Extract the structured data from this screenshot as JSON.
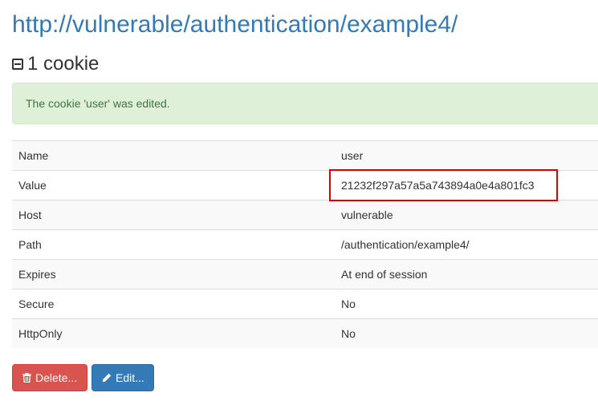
{
  "page": {
    "url_title": "http://vulnerable/authentication/example4/",
    "cookie_count_heading": "1 cookie"
  },
  "alert": {
    "message": "The cookie 'user' was edited."
  },
  "cookie": {
    "rows": [
      {
        "key": "Name",
        "value": "user"
      },
      {
        "key": "Value",
        "value": "21232f297a57a5a743894a0e4a801fc3"
      },
      {
        "key": "Host",
        "value": "vulnerable"
      },
      {
        "key": "Path",
        "value": "/authentication/example4/"
      },
      {
        "key": "Expires",
        "value": "At end of session"
      },
      {
        "key": "Secure",
        "value": "No"
      },
      {
        "key": "HttpOnly",
        "value": "No"
      }
    ]
  },
  "actions": {
    "delete_label": "Delete...",
    "edit_label": "Edit..."
  },
  "icons": {
    "collapse": "minus-square-icon",
    "delete": "trash-icon",
    "edit": "pencil-icon"
  },
  "colors": {
    "link": "#337ab7",
    "alert_bg": "#dff0d8",
    "alert_text": "#3c763d",
    "delete": "#d9534f",
    "edit": "#337ab7",
    "highlight": "#e00000"
  }
}
